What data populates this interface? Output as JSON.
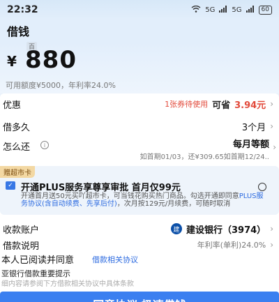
{
  "status": {
    "time": "22:32",
    "net1": "5G",
    "net2": "5G",
    "battery": "60"
  },
  "header": {
    "title": "借钱"
  },
  "amount": {
    "currency": "¥",
    "unit_tag": "百",
    "value": "880",
    "limit_text": "可用额度¥5000，年利率24.0%"
  },
  "discount": {
    "label": "优惠",
    "coupon": "1张券待使用",
    "save_label": "可省",
    "save_amount": "3.94元"
  },
  "term": {
    "label": "借多久",
    "value": "3个月"
  },
  "repay": {
    "label": "怎么还",
    "value": "每月等额",
    "detail": "如首期01/03，还¥309.65如首期12/24.."
  },
  "plus": {
    "badge": "赠超市卡",
    "title": "开通PLUS服务享尊享审批 首月仅99元",
    "desc_plain1": "开通首月送50元买吖超市卡，可当钱花购买热门商品。勾选开通即同意",
    "desc_link": "PLUS服务协议(含自动续费、先享后付)",
    "desc_plain2": "，次月按129元/月续费，可随时取消"
  },
  "account": {
    "label": "收款账户",
    "bank_logo": "建",
    "bank": "建设银行（3974）"
  },
  "desc_row": {
    "label": "借款说明",
    "value": "年利率(单利)24.0%"
  },
  "agreement": {
    "text": "本人已阅读并同意",
    "link": "借款相关协议",
    "notice_title": "亚银行借款重要提示",
    "notice_text": "细内容请参阅下方借款相关协议中具体条款"
  },
  "cta": {
    "label": "同意协议 极速借钱"
  }
}
